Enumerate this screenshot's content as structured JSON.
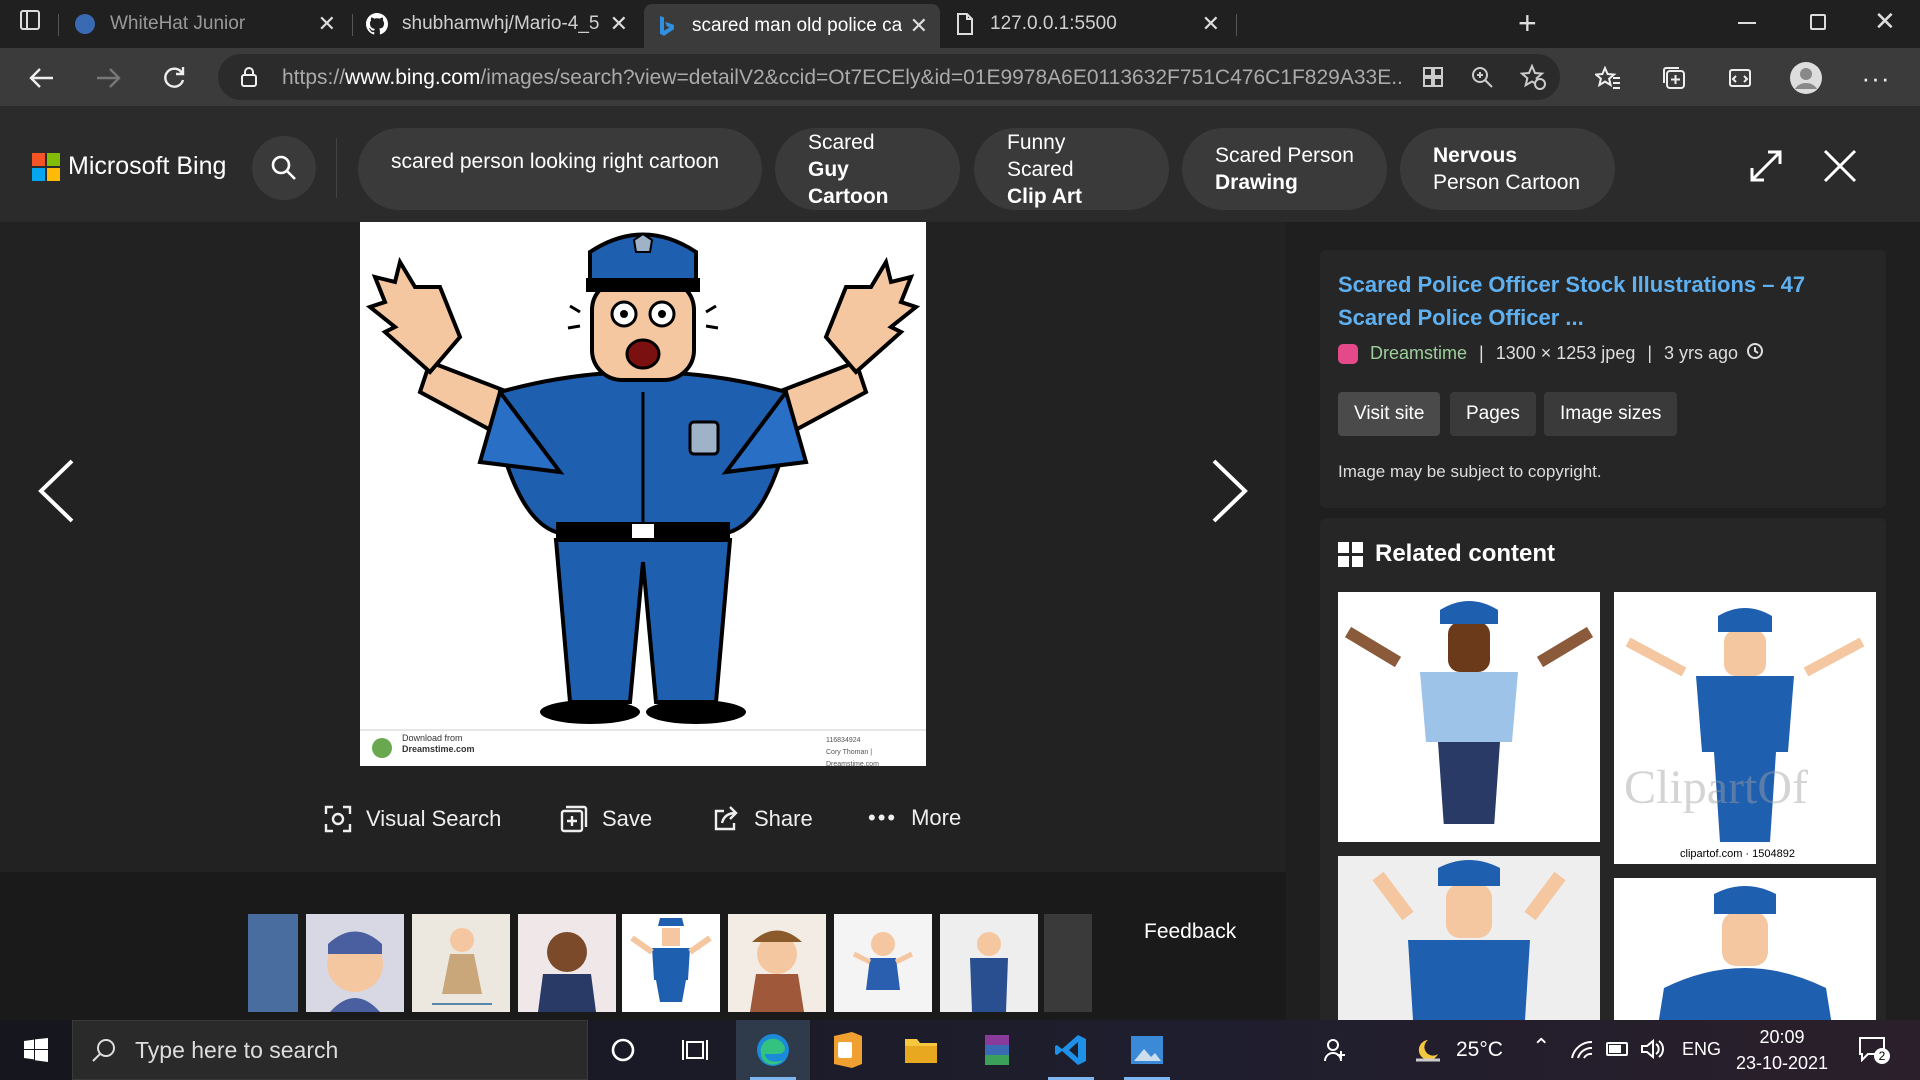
{
  "tabs": [
    {
      "title": "WhiteHat Junior",
      "icon": "whitehat-favicon"
    },
    {
      "title": "shubhamwhj/Mario-4_5",
      "icon": "github-icon"
    },
    {
      "title": "scared man old police cartoon - I",
      "icon": "bing-icon",
      "active": true
    },
    {
      "title": "127.0.0.1:5500",
      "icon": "document-icon"
    }
  ],
  "address": {
    "prefix": "https://",
    "domain": "www.bing.com",
    "rest": "/images/search?view=detailV2&ccid=Ot7ECEly&id=01E9978A6E0113632F751C476C1F829A33E..."
  },
  "bing": {
    "logo_text": "Microsoft Bing",
    "pills": [
      {
        "line1": "scared person looking right cartoon",
        "line2": "",
        "bold": "none"
      },
      {
        "line1": "Scared",
        "line2": "Guy Cartoon",
        "bold": "line2"
      },
      {
        "line1": "Funny Scared",
        "line2": "Clip Art",
        "bold": "line2"
      },
      {
        "line1": "Scared Person",
        "line2": "Drawing",
        "bold": "line2"
      },
      {
        "line1": "Nervous",
        "line2": "Person Cartoon",
        "bold": "line1"
      }
    ]
  },
  "image": {
    "watermark_line1": "Download from",
    "watermark_line2": "Dreamstime.com",
    "id_text": "116834924",
    "credit_text": "Cory Thoman | Dreamstime.com"
  },
  "actions": {
    "visual_search": "Visual Search",
    "save": "Save",
    "share": "Share",
    "more": "More"
  },
  "feedback": "Feedback",
  "detail": {
    "title_line1": "Scared Police Officer Stock Illustrations – 47",
    "title_line2": "Scared Police Officer ...",
    "source": "Dreamstime",
    "dimensions": "1300 × 1253 jpeg",
    "age": "3 yrs ago",
    "visit_site": "Visit site",
    "pages": "Pages",
    "image_sizes": "Image sizes",
    "copyright": "Image may be subject to copyright."
  },
  "related": {
    "heading": "Related content",
    "caption2": "clipartof.com · 1504892",
    "watermark2": "ClipartOf"
  },
  "taskbar": {
    "search_placeholder": "Type here to search",
    "temperature": "25°C",
    "language": "ENG",
    "time": "20:09",
    "date": "23-10-2021",
    "notifications": "2"
  },
  "colors": {
    "link_blue": "#5fb0f0",
    "police_blue": "#1f5fb0",
    "bing_bg": "#2b2b2b"
  }
}
